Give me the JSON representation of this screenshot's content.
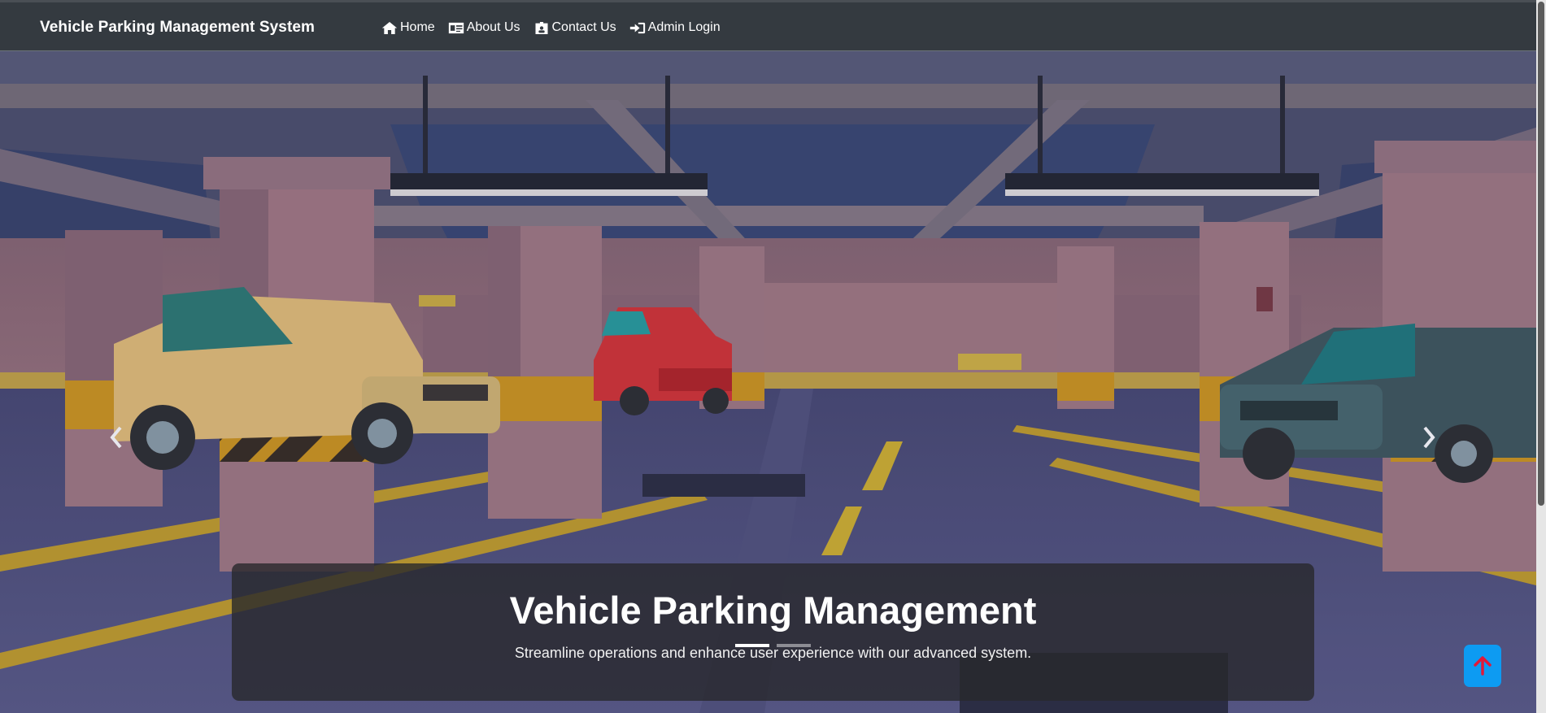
{
  "navbar": {
    "brand": "Vehicle Parking Management System",
    "items": [
      {
        "label": "Home",
        "icon": "home-icon"
      },
      {
        "label": "About Us",
        "icon": "id-card-icon"
      },
      {
        "label": "Contact Us",
        "icon": "id-badge-icon"
      },
      {
        "label": "Admin Login",
        "icon": "sign-in-icon"
      }
    ]
  },
  "carousel": {
    "caption_title": "Vehicle Parking Management",
    "caption_text": "Streamline operations and enhance user experience with our advanced system.",
    "slide_count": 2,
    "active_slide": 1,
    "prev_icon": "chevron-left-icon",
    "next_icon": "chevron-right-icon"
  },
  "back_to_top": {
    "icon": "arrow-up-icon"
  },
  "colors": {
    "navbar_bg": "#343a40",
    "accent_button": "#0d9bf2",
    "arrow_red": "#e0193a",
    "caption_bg": "rgba(40,40,44,0.80)"
  }
}
